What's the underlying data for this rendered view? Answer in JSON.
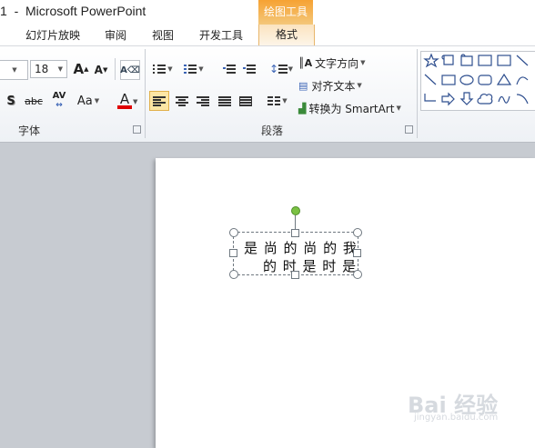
{
  "window": {
    "title": "1  -  Microsoft PowerPoint",
    "context_tab_group": "绘图工具"
  },
  "tabs": [
    {
      "label": "幻灯片放映"
    },
    {
      "label": "审阅"
    },
    {
      "label": "视图"
    },
    {
      "label": "开发工具"
    },
    {
      "label": "格式",
      "active": true
    }
  ],
  "font_group": {
    "label": "字体",
    "font_size": "18",
    "grow_font": "A",
    "shrink_font": "A",
    "shadow": "S",
    "strikethrough": "abc",
    "char_spacing": "AV",
    "change_case": "Aa",
    "font_color": "A",
    "font_color_hex": "#e00000"
  },
  "paragraph_group": {
    "label": "段落",
    "text_direction": "文字方向",
    "align_text": "对齐文本",
    "convert_smartart": "转换为 SmartArt"
  },
  "shapes_gallery": {
    "icons": [
      "star-shape-icon",
      "scroll-shape-icon",
      "scroll-horizontal-icon",
      "textbox-shape-icon",
      "vertical-textbox-icon",
      "line-shape-icon",
      "line-diagonal-icon",
      "rectangle-shape-icon",
      "oval-shape-icon",
      "rounded-rectangle-icon",
      "triangle-shape-icon",
      "curve-shape-icon",
      "elbow-connector-icon",
      "right-arrow-shape-icon",
      "down-arrow-shape-icon",
      "cloud-shape-icon",
      "scribble-shape-icon",
      "arc-shape-icon"
    ]
  },
  "slide": {
    "textbox_lines": [
      "是 尚 的 尚 的 我",
      "的 时 是 时 是"
    ]
  },
  "watermark": {
    "text": "Bai 经验",
    "sub": "jingyan.baidu.com"
  }
}
